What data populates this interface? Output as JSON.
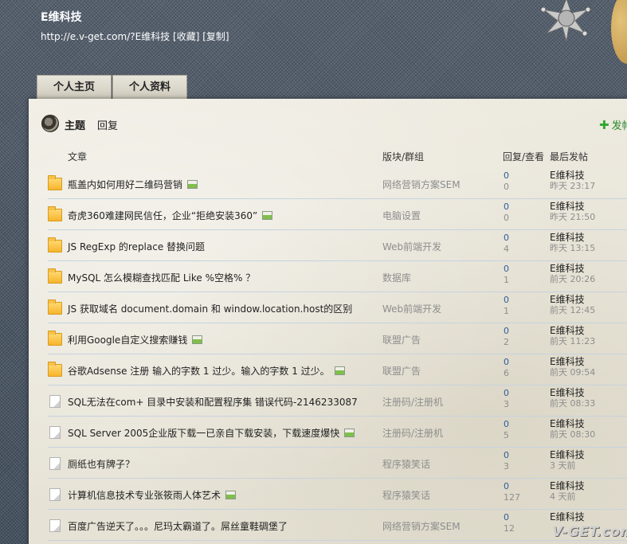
{
  "header": {
    "title": "E维科技",
    "url_text": "http://e.v-get.com/?E维科技",
    "favorite_label": "[收藏]",
    "copy_label": "[复制]"
  },
  "tabs": [
    "个人主页",
    "个人资料"
  ],
  "subnav": {
    "items": [
      "主题",
      "回复"
    ],
    "post_label": "发帖"
  },
  "columns": {
    "title": "文章",
    "forum": "版块/群组",
    "stats": "回复/查看",
    "last_post": "最后发帖"
  },
  "threads": [
    {
      "icon": "folder",
      "title": "瓶盖内如何用好二维码营销",
      "has_image": true,
      "forum": "网络营销方案SEM",
      "replies": "0",
      "views": "0",
      "user": "E维科技",
      "time": "昨天 23:17"
    },
    {
      "icon": "folder",
      "title": "奇虎360难建网民信任，企业“拒绝安装360”",
      "has_image": true,
      "forum": "电脑设置",
      "replies": "0",
      "views": "0",
      "user": "E维科技",
      "time": "昨天 21:50"
    },
    {
      "icon": "folder",
      "title": "JS RegExp 的replace 替换问题",
      "has_image": false,
      "forum": "Web前端开发",
      "replies": "0",
      "views": "4",
      "user": "E维科技",
      "time": "昨天 13:15"
    },
    {
      "icon": "folder",
      "title": "MySQL 怎么模糊查找匹配 Like %空格% ？",
      "has_image": false,
      "forum": "数据库",
      "replies": "0",
      "views": "1",
      "user": "E维科技",
      "time": "前天 20:26"
    },
    {
      "icon": "folder",
      "title": "JS 获取域名 document.domain 和 window.location.host的区别",
      "has_image": false,
      "forum": "Web前端开发",
      "replies": "0",
      "views": "1",
      "user": "E维科技",
      "time": "前天 12:45"
    },
    {
      "icon": "folder",
      "title": "利用Google自定义搜索赚钱",
      "has_image": true,
      "forum": "联盟广告",
      "replies": "0",
      "views": "2",
      "user": "E维科技",
      "time": "前天 11:23"
    },
    {
      "icon": "folder",
      "title": "谷歌Adsense 注册 输入的字数 1 过少。输入的字数 1 过少。",
      "has_image": true,
      "forum": "联盟广告",
      "replies": "0",
      "views": "6",
      "user": "E维科技",
      "time": "前天 09:54"
    },
    {
      "icon": "doc",
      "title": "SQL无法在com+ 目录中安装和配置程序集 错误代码-2146233087",
      "has_image": false,
      "forum": "注册码/注册机",
      "replies": "0",
      "views": "3",
      "user": "E维科技",
      "time": "前天 08:33"
    },
    {
      "icon": "doc",
      "title": "SQL Server 2005企业版下载一已亲自下载安装，下载速度爆快",
      "has_image": true,
      "forum": "注册码/注册机",
      "replies": "0",
      "views": "5",
      "user": "E维科技",
      "time": "前天 08:30"
    },
    {
      "icon": "doc",
      "title": "厕纸也有牌子？",
      "has_image": false,
      "forum": "程序猿笑话",
      "replies": "0",
      "views": "3",
      "user": "E维科技",
      "time": "3 天前"
    },
    {
      "icon": "doc",
      "title": "计算机信息技术专业张筱雨人体艺术",
      "has_image": true,
      "forum": "程序猿笑话",
      "replies": "0",
      "views": "127",
      "user": "E维科技",
      "time": "4 天前"
    },
    {
      "icon": "doc",
      "title": "百度广告逆天了。。。尼玛太霸道了。屌丝童鞋碉堡了",
      "has_image": false,
      "forum": "网络营销方案SEM",
      "replies": "0",
      "views": "12",
      "user": "E维科技",
      "time": ""
    }
  ],
  "watermark": "V-GET.com",
  "colors": {
    "reply_count": "#2d5d9a",
    "muted": "#8d8d8d",
    "row_divider": "#c6d3df",
    "folder": "#f6b52c",
    "post_green": "#2a8a2a"
  }
}
